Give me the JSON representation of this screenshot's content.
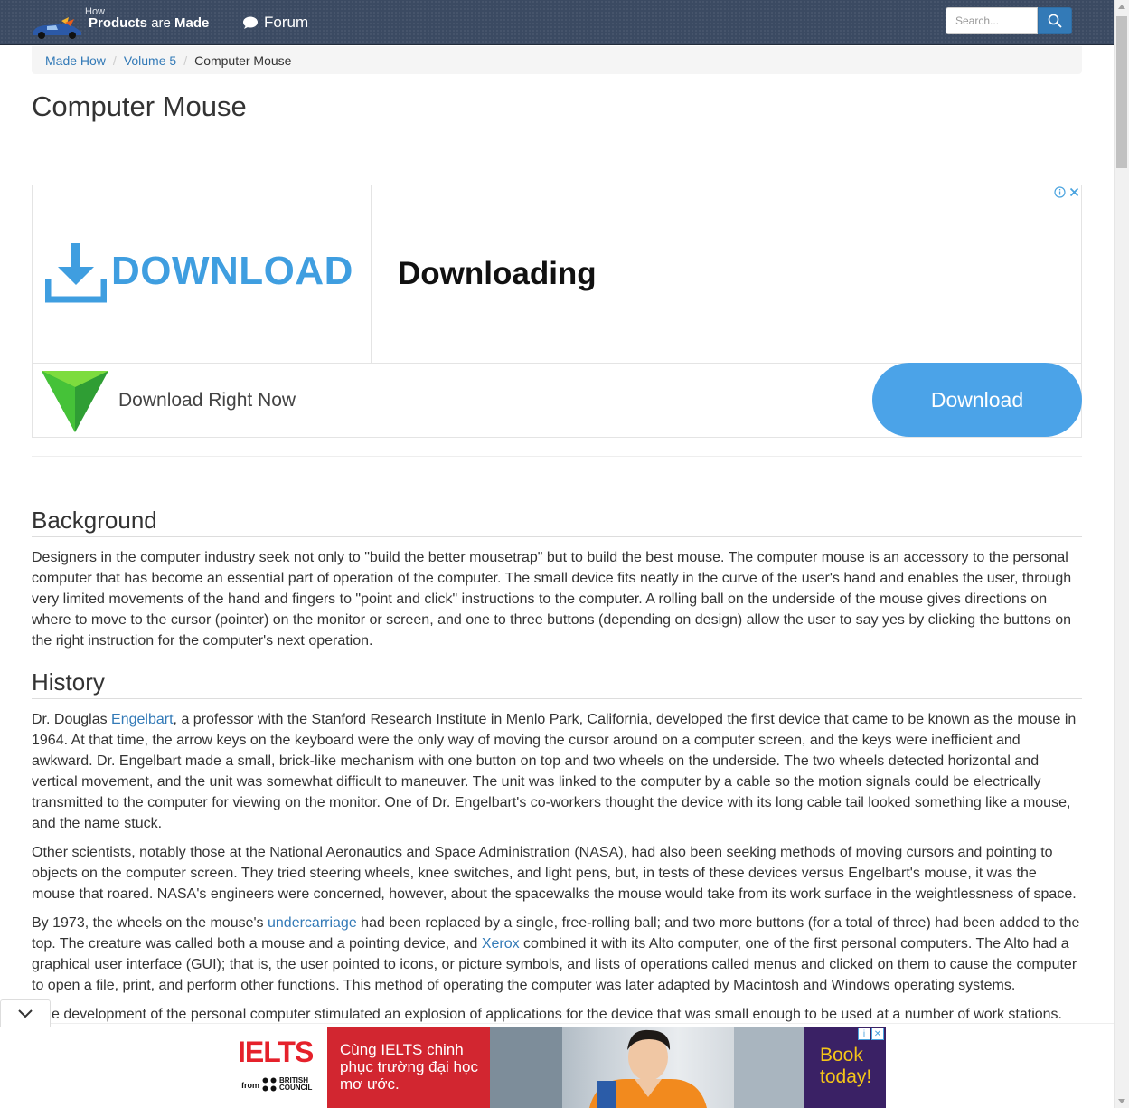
{
  "navbar": {
    "logo_how": "How",
    "logo_products": "Products",
    "logo_are": "are",
    "logo_made": "Made",
    "forum_label": "Forum",
    "search_placeholder": "Search..."
  },
  "breadcrumb": {
    "items": [
      "Made How",
      "Volume 5"
    ],
    "current": "Computer Mouse"
  },
  "page": {
    "title": "Computer Mouse"
  },
  "ad": {
    "logo_text": "DOWNLOAD",
    "headline": "Downloading",
    "subtext": "Download Right Now",
    "cta": "Download",
    "accent_color": "#4ba3e8"
  },
  "article": {
    "sections": [
      {
        "heading": "Background",
        "paragraphs": [
          "Designers in the computer industry seek not only to \"build the better mousetrap\" but to build the best mouse. The computer mouse is an accessory to the personal computer that has become an essential part of operation of the computer. The small device fits neatly in the curve of the user's hand and enables the user, through very limited movements of the hand and fingers to \"point and click\" instructions to the computer. A rolling ball on the underside of the mouse gives directions on where to move to the cursor (pointer) on the monitor or screen, and one to three buttons (depending on design) allow the user to say yes by clicking the buttons on the right instruction for the computer's next operation."
        ]
      },
      {
        "heading": "History",
        "p1_before": "Dr. Douglas ",
        "p1_link": "Engelbart",
        "p1_after": ", a professor with the Stanford Research Institute in Menlo Park, California, developed the first device that came to be known as the mouse in 1964. At that time, the arrow keys on the keyboard were the only way of moving the cursor around on a computer screen, and the keys were inefficient and awkward. Dr. Engelbart made a small, brick-like mechanism with one button on top and two wheels on the underside. The two wheels detected horizontal and vertical movement, and the unit was somewhat difficult to maneuver. The unit was linked to the computer by a cable so the motion signals could be electrically transmitted to the computer for viewing on the monitor. One of Dr. Engelbart's co-workers thought the device with its long cable tail looked something like a mouse, and the name stuck.",
        "p2": "Other scientists, notably those at the National Aeronautics and Space Administration (NASA), had also been seeking methods of moving cursors and pointing to objects on the computer screen. They tried steering wheels, knee switches, and light pens, but, in tests of these devices versus Engelbart's mouse, it was the mouse that roared. NASA's engineers were concerned, however, about the spacewalks the mouse would take from its work surface in the weightlessness of space.",
        "p3_a": "By 1973, the wheels on the mouse's ",
        "p3_link1": "undercarriage",
        "p3_b": " had been replaced by a single, free-rolling ball; and two more buttons (for a total of three) had been added to the top. The creature was called both a mouse and a pointing device, and ",
        "p3_link2": "Xerox",
        "p3_c": " combined it with its Alto computer, one of the first personal computers. The Alto had a graphical user interface (GUI); that is, the user pointed to icons, or picture symbols, and lists of operations called menus and clicked on them to cause the computer to open a file, print, and perform other functions. This method of operating the computer was later adapted by Macintosh and Windows operating systems.",
        "p4": "e development of the personal computer stimulated an explosion of applications for the device that was small enough to be used at a number of work stations."
      }
    ]
  },
  "bottom_ad": {
    "brand": "IELTS",
    "from": "from",
    "council": "BRITISH\nCOUNCIL",
    "tagline": "Cùng IELTS chinh phục trường đại học mơ ước.",
    "cta": "Book today!",
    "brand_color": "#e5212b",
    "cta_bg": "#3a2165",
    "cta_color": "#f5c518"
  }
}
